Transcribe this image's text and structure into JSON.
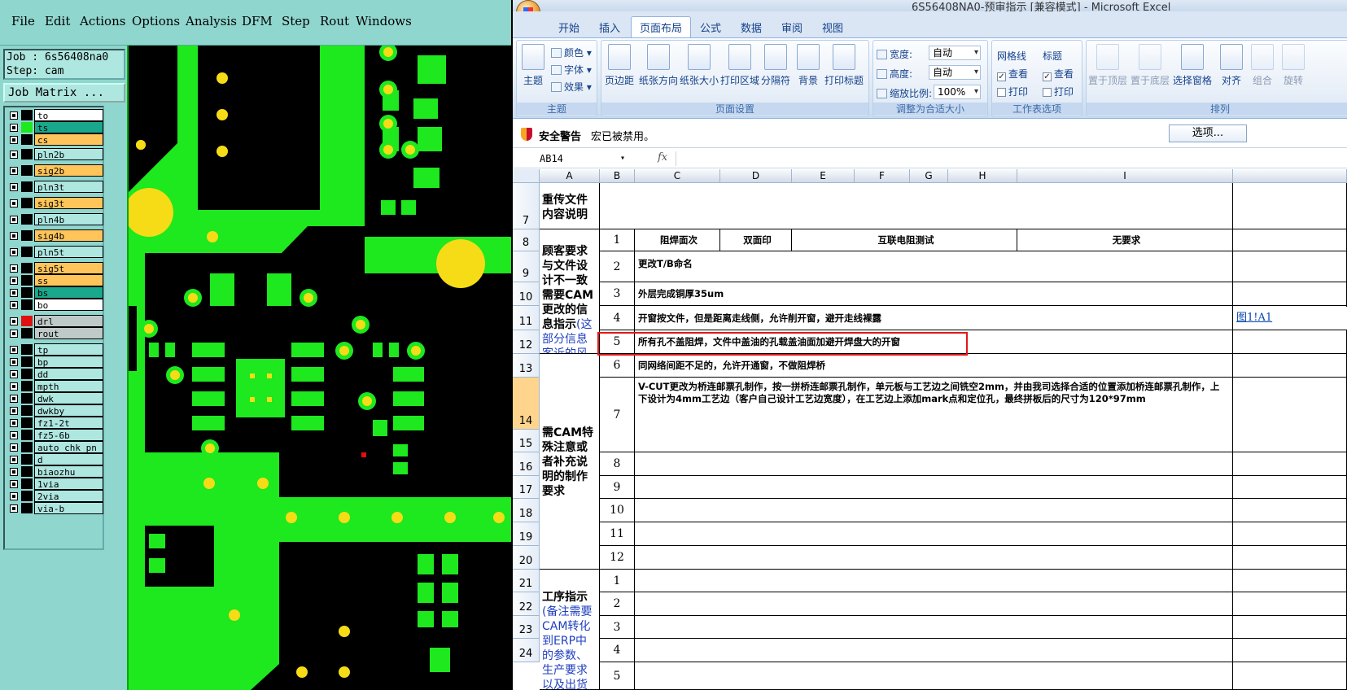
{
  "cam": {
    "menu": [
      "File",
      "Edit",
      "Actions",
      "Options",
      "Analysis",
      "DFM",
      "Step",
      "Rout",
      "Windows"
    ],
    "job_label": "Job : 6s56408na0",
    "step_label": "Step: cam",
    "job_matrix": "Job Matrix ...",
    "layers": [
      {
        "name": "to",
        "swatch": "#000000",
        "bg": "white"
      },
      {
        "name": "ts",
        "swatch": "#1ee81e",
        "bg": "teal"
      },
      {
        "name": "cs",
        "swatch": "#000000",
        "bg": "orange"
      },
      {
        "name": "pln2b",
        "swatch": "#000000",
        "bg": "cyan"
      },
      {
        "name": "sig2b",
        "swatch": "#000000",
        "bg": "orange"
      },
      {
        "name": "pln3t",
        "swatch": "#000000",
        "bg": "cyan"
      },
      {
        "name": "sig3t",
        "swatch": "#000000",
        "bg": "orange"
      },
      {
        "name": "pln4b",
        "swatch": "#000000",
        "bg": "cyan"
      },
      {
        "name": "sig4b",
        "swatch": "#000000",
        "bg": "orange"
      },
      {
        "name": "pln5t",
        "swatch": "#000000",
        "bg": "cyan"
      },
      {
        "name": "sig5t",
        "swatch": "#000000",
        "bg": "orange"
      },
      {
        "name": "ss",
        "swatch": "#000000",
        "bg": "orange"
      },
      {
        "name": "bs",
        "swatch": "#000000",
        "bg": "teal"
      },
      {
        "name": "bo",
        "swatch": "#000000",
        "bg": "white"
      },
      {
        "name": "drl",
        "swatch": "#e01010",
        "bg": "grey"
      },
      {
        "name": "rout",
        "swatch": "#000000",
        "bg": "grey"
      },
      {
        "name": "tp",
        "swatch": "#000000",
        "bg": "cyan"
      },
      {
        "name": "bp",
        "swatch": "#000000",
        "bg": "cyan"
      },
      {
        "name": "dd",
        "swatch": "#000000",
        "bg": "cyan"
      },
      {
        "name": "mpth",
        "swatch": "#000000",
        "bg": "cyan"
      },
      {
        "name": "dwk",
        "swatch": "#000000",
        "bg": "cyan"
      },
      {
        "name": "dwkby",
        "swatch": "#000000",
        "bg": "cyan"
      },
      {
        "name": "fz1-2t",
        "swatch": "#000000",
        "bg": "cyan"
      },
      {
        "name": "fz5-6b",
        "swatch": "#000000",
        "bg": "cyan"
      },
      {
        "name": "auto_chk_pn",
        "swatch": "#000000",
        "bg": "cyan"
      },
      {
        "name": "d",
        "swatch": "#000000",
        "bg": "cyan"
      },
      {
        "name": "biaozhu",
        "swatch": "#000000",
        "bg": "cyan"
      },
      {
        "name": "1via",
        "swatch": "#000000",
        "bg": "cyan"
      },
      {
        "name": "2via",
        "swatch": "#000000",
        "bg": "cyan"
      },
      {
        "name": "via-b",
        "swatch": "#000000",
        "bg": "cyan"
      }
    ]
  },
  "excel": {
    "title": "6S56408NA0-预审指示  [兼容模式] - Microsoft Excel",
    "tabs": [
      "开始",
      "插入",
      "页面布局",
      "公式",
      "数据",
      "审阅",
      "视图"
    ],
    "active_tab": "页面布局",
    "ribbon": {
      "theme_group": "主题",
      "theme_btn": "主题",
      "colors": "颜色",
      "fonts": "字体",
      "effects": "效果",
      "page_setup_group": "页面设置",
      "margins": "页边距",
      "orientation": "纸张方向",
      "size": "纸张大小",
      "print_area": "打印区域",
      "breaks": "分隔符",
      "background": "背景",
      "print_titles": "打印标题",
      "scale_group": "调整为合适大小",
      "width_label": "宽度:",
      "width_value": "自动",
      "height_label": "高度:",
      "height_value": "自动",
      "scale_label": "缩放比例:",
      "scale_value": "100%",
      "sheet_options_group": "工作表选项",
      "gridlines": "网格线",
      "headings": "标题",
      "view": "查看",
      "print": "打印",
      "arrange_group": "排列",
      "bring_front": "置于顶层",
      "send_back": "置于底层",
      "selection_pane": "选择窗格",
      "align": "对齐",
      "group": "组合",
      "rotate": "旋转"
    },
    "security": {
      "title": "安全警告",
      "message": "宏已被禁用。",
      "options": "选项..."
    },
    "namebox": "AB14",
    "fx": "fx",
    "columns": [
      "A",
      "B",
      "C",
      "D",
      "E",
      "F",
      "G",
      "H",
      "I"
    ],
    "rows": [
      "7",
      "8",
      "9",
      "10",
      "11",
      "12",
      "13",
      "14",
      "15",
      "16",
      "17",
      "18",
      "19",
      "20",
      "21",
      "22",
      "23",
      "24"
    ],
    "section_upload": "重传文件\n内容说明",
    "section_customer_a": "顾客要求与文件设计不一致需要CAM更改的信息指示",
    "section_customer_b": "(这部分信息客诉的风险最高)",
    "section_special": "需CAM特殊注意或者补充说明的制作要求",
    "section_process_a": "工序指示",
    "section_process_b": "(备注需要CAM转化到ERP中的参数、生产要求以及出货要求)",
    "row8": {
      "n": "1",
      "c": "阻焊面次",
      "d": "双面印",
      "ef": "互联电阻测试",
      "i": "无要求"
    },
    "items": [
      {
        "n": "2",
        "text": "更改T/B命名"
      },
      {
        "n": "3",
        "text": "外层完成铜厚35um"
      },
      {
        "n": "4",
        "text": "开窗按文件，但是距离走线侧，允许削开窗，避开走线裸露"
      },
      {
        "n": "5",
        "text": "所有孔不盖阻焊，文件中盖油的孔载盖油面加避开焊盘大的开窗"
      },
      {
        "n": "6",
        "text": "同网络间距不足的，允许开通窗，不做阻焊桥"
      },
      {
        "n": "7",
        "text": "V-CUT更改为桥连邮票孔制作，按一拼桥连邮票孔制作，单元板与工艺边之间铣空2mm，并由我司选择合适的位置添加桥连邮票孔制作，上下设计为4mm工艺边（客户自己设计工艺边宽度），在工艺边上添加mark点和定位孔，最终拼板后的尺寸为120*97mm"
      },
      {
        "n": "8",
        "text": ""
      },
      {
        "n": "9",
        "text": ""
      },
      {
        "n": "10",
        "text": ""
      },
      {
        "n": "11",
        "text": ""
      },
      {
        "n": "12",
        "text": ""
      }
    ],
    "process_items": [
      "1",
      "2",
      "3",
      "4",
      "5"
    ],
    "link_text": "图1!A1"
  }
}
